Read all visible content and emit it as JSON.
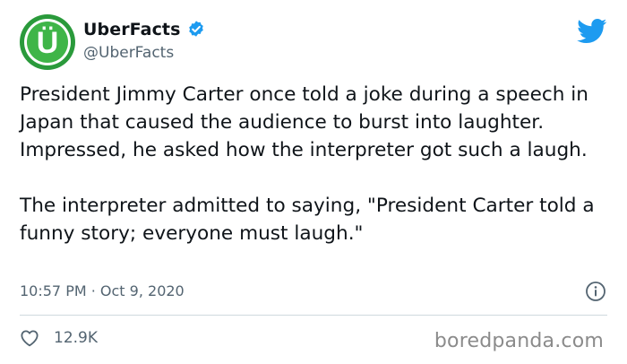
{
  "account": {
    "display_name": "UberFacts",
    "handle": "@UberFacts",
    "avatar_letter": "Ü"
  },
  "tweet": {
    "text": "President Jimmy Carter once told a joke during a speech in Japan that caused the audience to burst into laughter. Impressed, he asked how the interpreter got such a laugh.\n\nThe interpreter admitted to saying, \"President Carter told a funny story; everyone must laugh.\"",
    "timestamp": "10:57 PM · Oct 9, 2020",
    "like_count": "12.9K"
  },
  "watermark": "boredpanda.com",
  "icons": {
    "avatar": "uberfacts-logo-icon",
    "verified": "verified-badge-icon",
    "brand": "twitter-bird-icon",
    "info": "info-icon",
    "like": "heart-icon"
  },
  "colors": {
    "avatar_green": "#2a9a3b",
    "avatar_light": "#6fd16f",
    "verified_blue": "#1d9bf0",
    "twitter_blue": "#1d9bf0",
    "muted_text": "#536471"
  }
}
